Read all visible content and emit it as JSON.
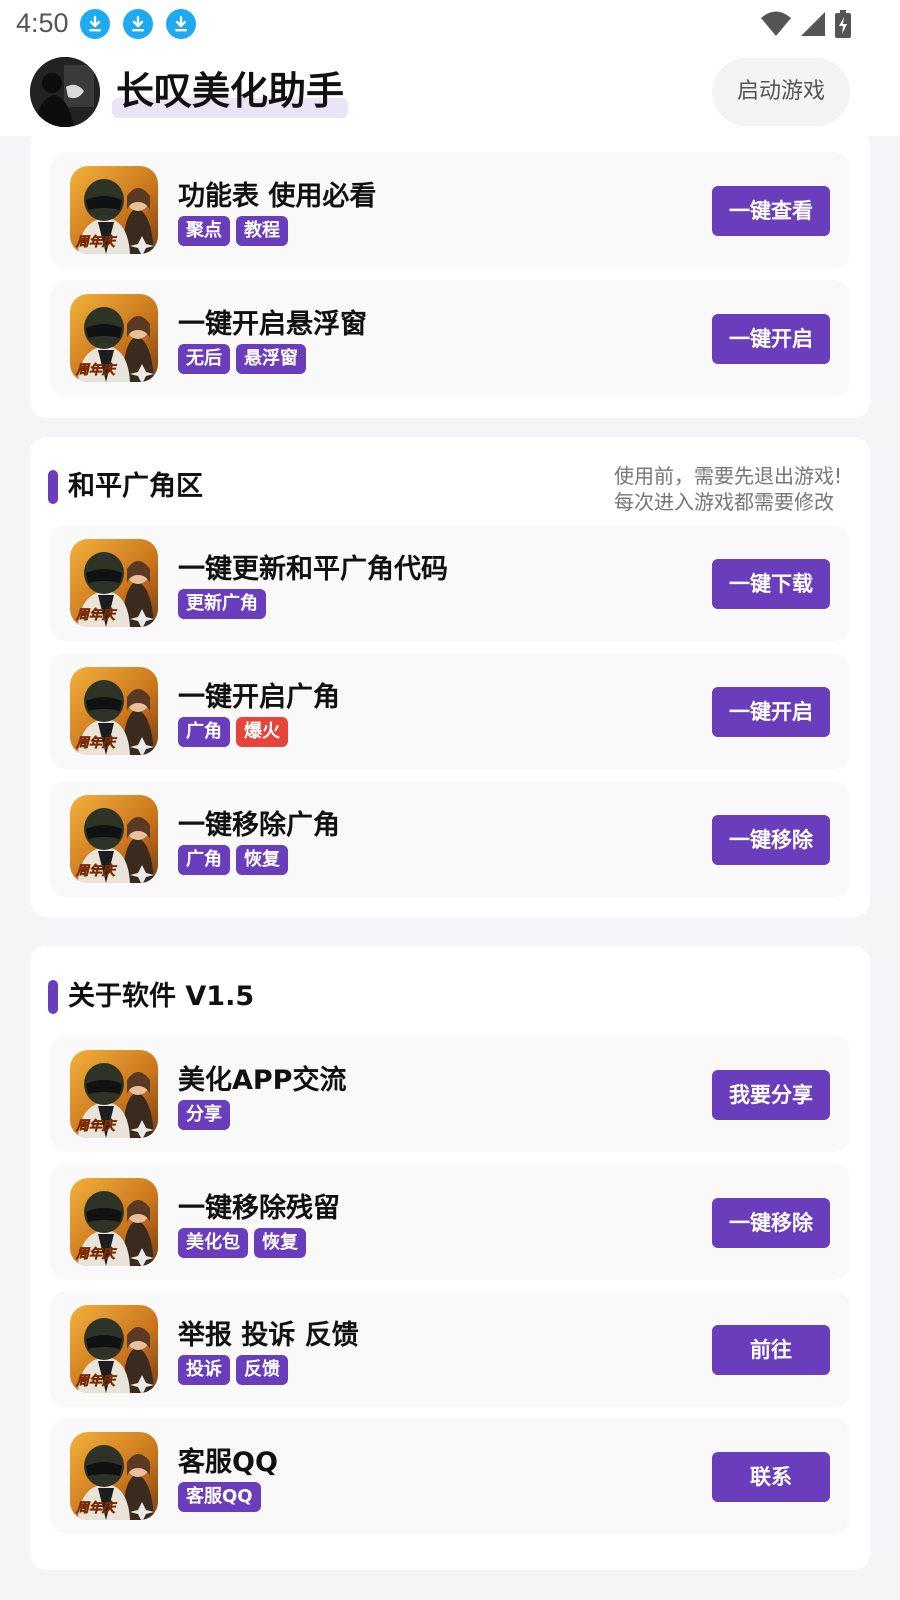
{
  "status_bar": {
    "time": "4:50",
    "download_icon_count": 3,
    "icons": [
      "download-icon",
      "wifi-icon",
      "signal-icon",
      "battery-charging-icon"
    ]
  },
  "header": {
    "title": "长叹美化助手",
    "start_game_label": "启动游戏",
    "accent_color": "#6a3dbd"
  },
  "section1": {
    "items": [
      {
        "title": "功能表 使用必看",
        "tags": [
          {
            "text": "聚点",
            "color": "purple"
          },
          {
            "text": "教程",
            "color": "purple"
          }
        ],
        "button": "一键查看"
      },
      {
        "title": "一键开启悬浮窗",
        "tags": [
          {
            "text": "无后",
            "color": "purple"
          },
          {
            "text": "悬浮窗",
            "color": "purple"
          }
        ],
        "button": "一键开启"
      }
    ]
  },
  "section2": {
    "title": "和平广角区",
    "note_line1": "使用前，需要先退出游戏!",
    "note_line2": "每次进入游戏都需要修改",
    "items": [
      {
        "title": "一键更新和平广角代码",
        "tags": [
          {
            "text": "更新广角",
            "color": "purple"
          }
        ],
        "button": "一键下载"
      },
      {
        "title": "一键开启广角",
        "tags": [
          {
            "text": "广角",
            "color": "purple"
          },
          {
            "text": "爆火",
            "color": "red"
          }
        ],
        "button": "一键开启"
      },
      {
        "title": "一键移除广角",
        "tags": [
          {
            "text": "广角",
            "color": "purple"
          },
          {
            "text": "恢复",
            "color": "purple"
          }
        ],
        "button": "一键移除"
      }
    ]
  },
  "section3": {
    "title": "关于软件 V1.5",
    "items": [
      {
        "title": "美化APP交流",
        "tags": [
          {
            "text": "分享",
            "color": "purple"
          }
        ],
        "button": "我要分享"
      },
      {
        "title": "一键移除残留",
        "tags": [
          {
            "text": "美化包",
            "color": "purple"
          },
          {
            "text": "恢复",
            "color": "purple"
          }
        ],
        "button": "一键移除"
      },
      {
        "title": "举报 投诉 反馈",
        "tags": [
          {
            "text": "投诉",
            "color": "purple"
          },
          {
            "text": "反馈",
            "color": "purple"
          }
        ],
        "button": "前往"
      },
      {
        "title": "客服QQ",
        "tags": [
          {
            "text": "客服QQ",
            "color": "purple"
          }
        ],
        "button": "联系"
      }
    ]
  },
  "icon_badge_text": "周年庆"
}
